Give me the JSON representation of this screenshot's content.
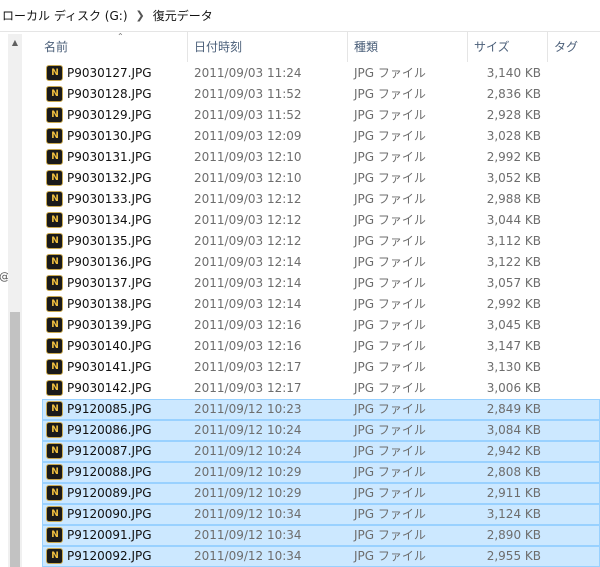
{
  "breadcrumb": {
    "drive": "ローカル ディスク (G:)",
    "folder": "復元データ"
  },
  "columns": {
    "name": "名前",
    "date": "日付時刻",
    "type": "種類",
    "size": "サイズ",
    "tags": "タグ"
  },
  "nav": {
    "fragment": "@"
  },
  "icons": {
    "file": "jpg-viewer-icon",
    "sort": "sort-up-icon",
    "scroll": "scroll-up-icon"
  },
  "files": [
    {
      "name": "P9030127.JPG",
      "date": "2011/09/03 11:24",
      "type": "JPG ファイル",
      "size": "3,140 KB",
      "selected": false
    },
    {
      "name": "P9030128.JPG",
      "date": "2011/09/03 11:52",
      "type": "JPG ファイル",
      "size": "2,836 KB",
      "selected": false
    },
    {
      "name": "P9030129.JPG",
      "date": "2011/09/03 11:52",
      "type": "JPG ファイル",
      "size": "2,928 KB",
      "selected": false
    },
    {
      "name": "P9030130.JPG",
      "date": "2011/09/03 12:09",
      "type": "JPG ファイル",
      "size": "3,028 KB",
      "selected": false
    },
    {
      "name": "P9030131.JPG",
      "date": "2011/09/03 12:10",
      "type": "JPG ファイル",
      "size": "2,992 KB",
      "selected": false
    },
    {
      "name": "P9030132.JPG",
      "date": "2011/09/03 12:10",
      "type": "JPG ファイル",
      "size": "3,052 KB",
      "selected": false
    },
    {
      "name": "P9030133.JPG",
      "date": "2011/09/03 12:12",
      "type": "JPG ファイル",
      "size": "2,988 KB",
      "selected": false
    },
    {
      "name": "P9030134.JPG",
      "date": "2011/09/03 12:12",
      "type": "JPG ファイル",
      "size": "3,044 KB",
      "selected": false
    },
    {
      "name": "P9030135.JPG",
      "date": "2011/09/03 12:12",
      "type": "JPG ファイル",
      "size": "3,112 KB",
      "selected": false
    },
    {
      "name": "P9030136.JPG",
      "date": "2011/09/03 12:14",
      "type": "JPG ファイル",
      "size": "3,122 KB",
      "selected": false
    },
    {
      "name": "P9030137.JPG",
      "date": "2011/09/03 12:14",
      "type": "JPG ファイル",
      "size": "3,057 KB",
      "selected": false
    },
    {
      "name": "P9030138.JPG",
      "date": "2011/09/03 12:14",
      "type": "JPG ファイル",
      "size": "2,992 KB",
      "selected": false
    },
    {
      "name": "P9030139.JPG",
      "date": "2011/09/03 12:16",
      "type": "JPG ファイル",
      "size": "3,045 KB",
      "selected": false
    },
    {
      "name": "P9030140.JPG",
      "date": "2011/09/03 12:16",
      "type": "JPG ファイル",
      "size": "3,147 KB",
      "selected": false
    },
    {
      "name": "P9030141.JPG",
      "date": "2011/09/03 12:17",
      "type": "JPG ファイル",
      "size": "3,130 KB",
      "selected": false
    },
    {
      "name": "P9030142.JPG",
      "date": "2011/09/03 12:17",
      "type": "JPG ファイル",
      "size": "3,006 KB",
      "selected": false
    },
    {
      "name": "P9120085.JPG",
      "date": "2011/09/12 10:23",
      "type": "JPG ファイル",
      "size": "2,849 KB",
      "selected": true
    },
    {
      "name": "P9120086.JPG",
      "date": "2011/09/12 10:24",
      "type": "JPG ファイル",
      "size": "3,084 KB",
      "selected": true
    },
    {
      "name": "P9120087.JPG",
      "date": "2011/09/12 10:24",
      "type": "JPG ファイル",
      "size": "2,942 KB",
      "selected": true
    },
    {
      "name": "P9120088.JPG",
      "date": "2011/09/12 10:29",
      "type": "JPG ファイル",
      "size": "2,808 KB",
      "selected": true
    },
    {
      "name": "P9120089.JPG",
      "date": "2011/09/12 10:29",
      "type": "JPG ファイル",
      "size": "2,911 KB",
      "selected": true
    },
    {
      "name": "P9120090.JPG",
      "date": "2011/09/12 10:34",
      "type": "JPG ファイル",
      "size": "3,124 KB",
      "selected": true
    },
    {
      "name": "P9120091.JPG",
      "date": "2011/09/12 10:34",
      "type": "JPG ファイル",
      "size": "2,890 KB",
      "selected": true
    },
    {
      "name": "P9120092.JPG",
      "date": "2011/09/12 10:34",
      "type": "JPG ファイル",
      "size": "2,955 KB",
      "selected": true
    }
  ]
}
